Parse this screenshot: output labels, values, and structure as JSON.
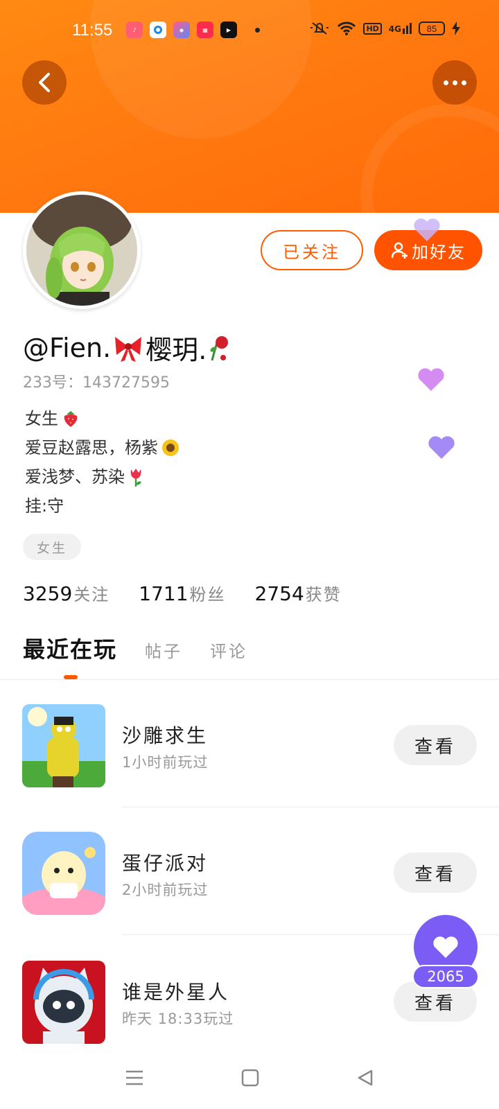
{
  "status_bar": {
    "time": "11:55",
    "battery": "85",
    "network_badge": "HD",
    "signal_label": "4G"
  },
  "profile": {
    "username": "@Fien.",
    "username_mid": "樱玥.",
    "id_line": "233号：143727595",
    "bio_lines": [
      "女生",
      "爱豆赵露思，杨紫",
      "爱浅梦、苏染",
      "挂:守"
    ],
    "tag": "女生"
  },
  "actions": {
    "follow_label": "已关注",
    "add_friend_label": "加好友"
  },
  "stats": {
    "following_count": "3259",
    "following_label": "关注",
    "followers_count": "1711",
    "followers_label": "粉丝",
    "likes_count": "2754",
    "likes_label": "获赞"
  },
  "tabs": [
    {
      "label": "最近在玩"
    },
    {
      "label": "帖子"
    },
    {
      "label": "评论"
    }
  ],
  "games": [
    {
      "name": "沙雕求生",
      "time": "1小时前玩过",
      "button": "查看"
    },
    {
      "name": "蛋仔派对",
      "time": "2小时前玩过",
      "button": "查看"
    },
    {
      "name": "谁是外星人",
      "time": "昨天 18:33玩过",
      "button": "查看"
    }
  ],
  "like_fab": {
    "count": "2065"
  },
  "colors": {
    "header_orange": "#ff7a10",
    "accent_orange": "#ff5300",
    "like_purple": "#7b5cf5"
  }
}
